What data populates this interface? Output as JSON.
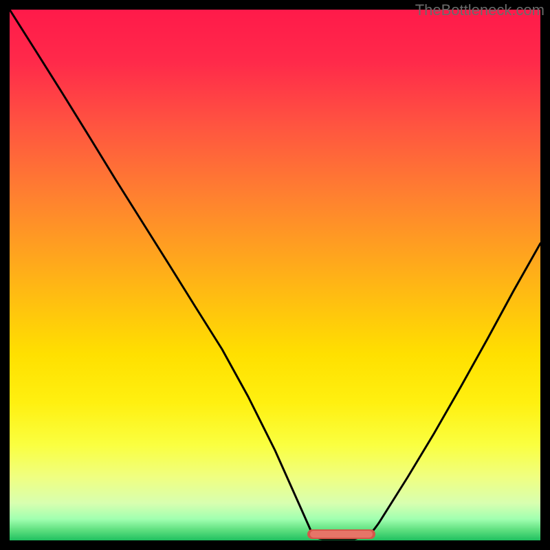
{
  "watermark": "TheBottleneck.com",
  "colors": {
    "gradient_top": "#ff1a4a",
    "gradient_mid": "#ffe000",
    "gradient_bottom": "#20c060",
    "curve": "#000000",
    "flat_marker": "#d4574a",
    "background": "#000000"
  },
  "chart_data": {
    "type": "line",
    "title": "",
    "xlabel": "",
    "ylabel": "",
    "xlim": [
      0,
      100
    ],
    "ylim": [
      0,
      100
    ],
    "grid": false,
    "series": [
      {
        "name": "bottleneck-curve",
        "x": [
          0,
          5,
          10,
          15,
          20,
          25,
          30,
          35,
          40,
          45,
          50,
          55,
          57,
          60,
          65,
          68,
          70,
          75,
          80,
          85,
          90,
          95,
          100
        ],
        "y": [
          100,
          92,
          84,
          76,
          68,
          60,
          52,
          44,
          36,
          27,
          17,
          6,
          1,
          0,
          0,
          1,
          4,
          12,
          20,
          29,
          38,
          47,
          56
        ]
      },
      {
        "name": "optimal-flat-region",
        "x": [
          57,
          68
        ],
        "y": [
          0,
          0
        ]
      }
    ],
    "annotations": [
      {
        "text": "TheBottleneck.com",
        "position": "top-right"
      }
    ]
  }
}
